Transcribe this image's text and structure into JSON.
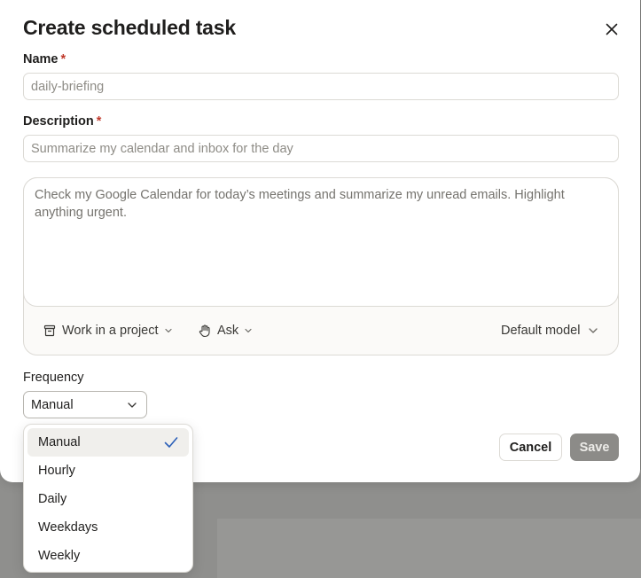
{
  "dialog": {
    "title": "Create scheduled task",
    "close_icon": "close-icon"
  },
  "name_field": {
    "label": "Name",
    "required_mark": "*",
    "placeholder": "daily-briefing",
    "value": ""
  },
  "description_field": {
    "label": "Description",
    "required_mark": "*",
    "placeholder": "Summarize my calendar and inbox for the day",
    "value": ""
  },
  "prompt": {
    "text": "Check my Google Calendar for today’s meetings and summarize my unread emails. Highlight anything urgent.",
    "toolbar": {
      "project_label": "Work in a project",
      "project_icon": "project-box-icon",
      "mode_label": "Ask",
      "mode_icon": "hand-icon",
      "model_label": "Default model"
    }
  },
  "frequency": {
    "label": "Frequency",
    "selected": "Manual",
    "options": [
      "Manual",
      "Hourly",
      "Daily",
      "Weekdays",
      "Weekly"
    ]
  },
  "actions": {
    "cancel_label": "Cancel",
    "save_label": "Save"
  },
  "colors": {
    "required": "#c0392b",
    "check": "#2b5fb8",
    "save_disabled_bg": "#8c8b88",
    "backdrop": "#7d7d7b"
  }
}
